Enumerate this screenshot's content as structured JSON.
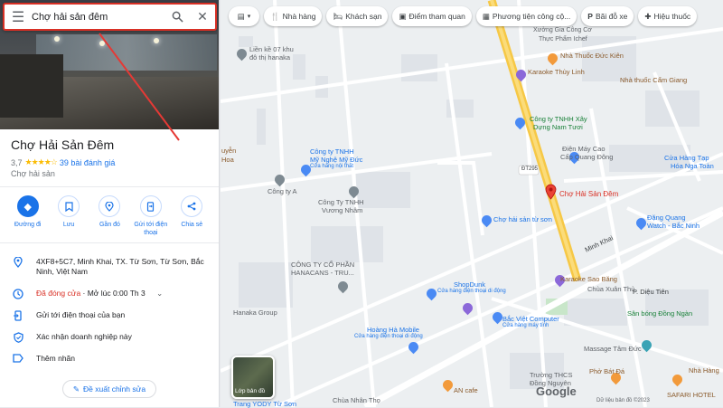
{
  "search": {
    "value": "Chợ hải sản đêm"
  },
  "place": {
    "name": "Chợ Hải Sản Đêm",
    "rating": "3,7",
    "stars": "★★★★☆",
    "reviews": "39 bài đánh giá",
    "category": "Chợ hải sản"
  },
  "actions": [
    {
      "label": "Đường đi",
      "icon": "directions-icon"
    },
    {
      "label": "Lưu",
      "icon": "bookmark-icon"
    },
    {
      "label": "Gần đó",
      "icon": "nearby-icon"
    },
    {
      "label": "Gửi tới điện thoại",
      "icon": "send-to-phone-icon"
    },
    {
      "label": "Chia sẻ",
      "icon": "share-icon"
    }
  ],
  "info": {
    "address": "4XF8+5C7, Minh Khai, TX. Từ Sơn, Từ Sơn, Bắc Ninh, Việt Nam",
    "hours_status": "Đã đóng cửa",
    "hours_next": " · Mở lúc 0:00 Th 3",
    "send_phone": "Gửi tới điện thoại của bạn",
    "claim": "Xác nhận doanh nghiệp này",
    "add_label": "Thêm nhãn"
  },
  "suggest_edit": "Đề xuất chỉnh sửa",
  "chips": [
    {
      "label": "Nhà hàng",
      "icon": "restaurant-icon"
    },
    {
      "label": "Khách sạn",
      "icon": "hotel-icon"
    },
    {
      "label": "Điểm tham quan",
      "icon": "camera-icon"
    },
    {
      "label": "Phương tiện công cộ...",
      "icon": "transit-icon"
    },
    {
      "label": "Bãi đỗ xe",
      "icon": "parking-icon"
    },
    {
      "label": "Hiệu thuốc",
      "icon": "pharmacy-icon"
    }
  ],
  "map_labels": {
    "lien_ke": "Liền kề 07 khu",
    "do_thi": "đô thị hanaka",
    "xuong": "Xưởng Gia Công Cơ",
    "thuc_pham": "Thực Phẩm Ichef",
    "nha_thuoc_duc_kien": "Nhà Thuốc Đức Kiên",
    "karaoke_thuy_linh": "Karaoke Thùy Linh",
    "nha_thuoc_cam_giang": "Nhà thuốc Cẩm Giang",
    "cong_ty_tnhh_xay": "Công ty TNHH Xây",
    "dung_nam_tuoi": "Dựng Nam Tươi",
    "dien_may": "Điện Máy Cao",
    "cap_quang_dong": "Cấp Quang Đông",
    "cua_hang_tap": "Cửa Hàng Tạp",
    "hoa_nga_toan": "Hóa Nga Toàn",
    "my_nghe_1": "Công ty TNHH",
    "my_nghe_2": "Mỹ Nghệ Mỹ Đức",
    "my_nghe_sub": "Cửa hàng nội thất",
    "cong_ty_a": "Công ty A",
    "vuong_nham_1": "Công Ty TNHH",
    "vuong_nham_2": "Vương Nhâm",
    "road": "ĐT295",
    "cho_hai_san_tu_son": "Chợ hải sản từ sơn",
    "selected": "Chợ Hải Sản Đêm",
    "dang_quang_1": "Đặng Quang",
    "dang_quang_2": "Watch - Bắc Ninh",
    "minh_khai": "Minh Khai",
    "hanacans_1": "CÔNG TY CỔ PHẦN",
    "hanacans_2": "HANACANS - TRU...",
    "hanaka_group": "Hanaka Group",
    "shopdunk": "ShopDunk",
    "shopdunk_sub": "Cửa hàng điện thoại di động",
    "karaoke_sao_bang": "Karaoke Sao Băng",
    "chua_xuan_thu": "Chùa Xuân Thủ",
    "dieu_tien": "P. Diệu Tiên",
    "san_bong": "Sân bóng Đồng Ngàn",
    "hoang_ha": "Hoàng Hà Mobile",
    "hoang_ha_sub": "Cửa hàng điện thoại di động",
    "bac_viet_1": "Bắc Việt Computer",
    "bac_viet_2": "Cửa hàng máy tính",
    "massage": "Massage Tâm Đức",
    "thcs_1": "Trường THCS",
    "thcs_2": "Đồng Nguyên",
    "pho_bat_da": "Phở Bát Đá",
    "nha_hang": "Nhà Hàng",
    "an_cafe": "AN cafe",
    "chua_nhan_tho": "Chùa Nhân Thọ",
    "trang_yody": "Trang YODY Từ Sơn",
    "safari": "SAFARI HOTEL",
    "yuyen": "uyễn",
    "hoa": "Hoa"
  },
  "layers_label": "Lớp bản đồ",
  "google": "Google",
  "copyright": "Dữ liệu bản đồ ©2023",
  "colors": {
    "accent": "#1a73e8",
    "closed": "#d93025",
    "road_main": "#f6c846",
    "pin_red": "#ea4335"
  }
}
